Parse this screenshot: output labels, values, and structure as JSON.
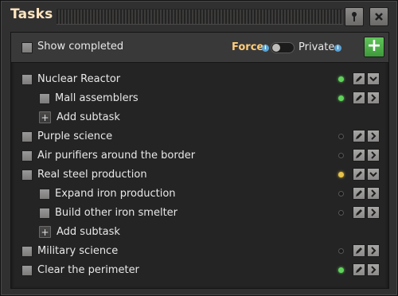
{
  "window": {
    "title": "Tasks",
    "pin_icon": "pin-icon",
    "close_icon": "close-icon"
  },
  "toolbar": {
    "show_completed_label": "Show completed",
    "force_label": "Force",
    "private_label": "Private",
    "add_icon": "plus-icon"
  },
  "colors": {
    "status_active": "#5fd35a",
    "status_inactive": "#1a1a1a",
    "status_pending": "#e6c34a",
    "add_button": "#4aab44",
    "force_text": "#ffce7a"
  },
  "tasks": [
    {
      "label": "Nuclear Reactor",
      "status": "green",
      "expanded": true
    },
    {
      "label": "Mall assemblers",
      "status": "green",
      "subtask": true
    },
    {
      "label": "Add subtask",
      "add": true
    },
    {
      "label": "Purple science",
      "status": "dark"
    },
    {
      "label": "Air purifiers around the border",
      "status": "dark"
    },
    {
      "label": "Real steel production",
      "status": "yellow",
      "expanded": true
    },
    {
      "label": "Expand iron production",
      "status": "dark",
      "subtask": true
    },
    {
      "label": "Build other iron smelter",
      "status": "dark",
      "subtask": true
    },
    {
      "label": "Add subtask",
      "add": true
    },
    {
      "label": "Military science",
      "status": "dark"
    },
    {
      "label": "Clear the perimeter",
      "status": "green"
    }
  ]
}
